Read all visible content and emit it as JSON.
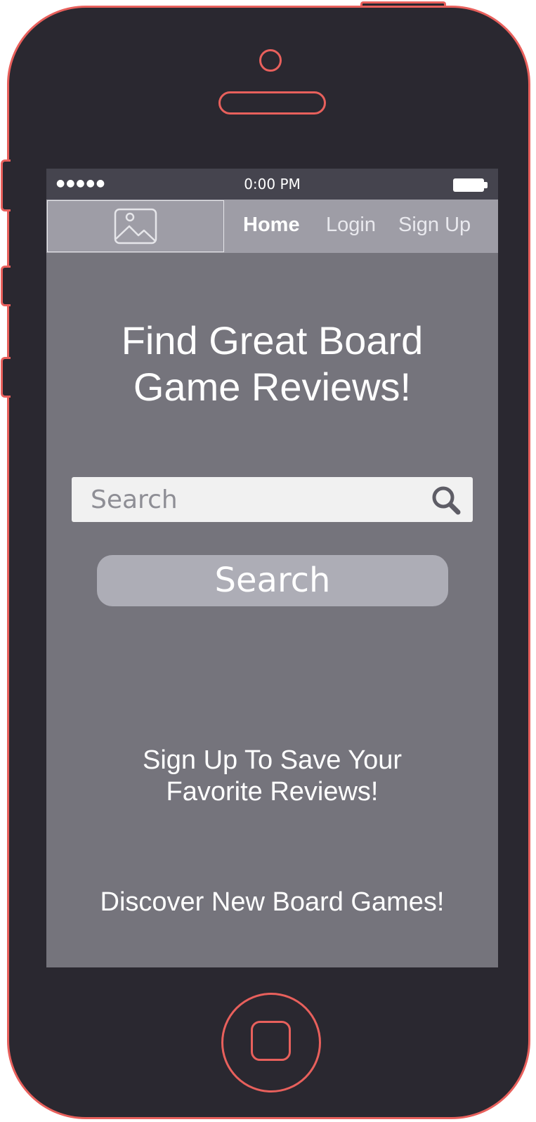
{
  "status_bar": {
    "signal": "●●●●●",
    "time": "0:00 PM"
  },
  "nav": {
    "logo_icon": "image-placeholder-icon",
    "home": "Home",
    "login": "Login",
    "signup": "Sign Up"
  },
  "hero": {
    "headline_line1": "Find Great Board",
    "headline_line2": "Game Reviews!"
  },
  "search": {
    "placeholder": "Search",
    "icon": "search-icon",
    "button_label": "Search"
  },
  "promos": {
    "signup_line1": "Sign Up To Save Your",
    "signup_line2": "Favorite Reviews!",
    "discover": "Discover New Board Games!"
  },
  "colors": {
    "phone_body": "#2a2830",
    "phone_outline": "#e8605c",
    "screen_bg": "#75747c",
    "status_bar_bg": "#45444e",
    "nav_bg": "#9e9da6",
    "search_button_bg": "#adadb6"
  }
}
